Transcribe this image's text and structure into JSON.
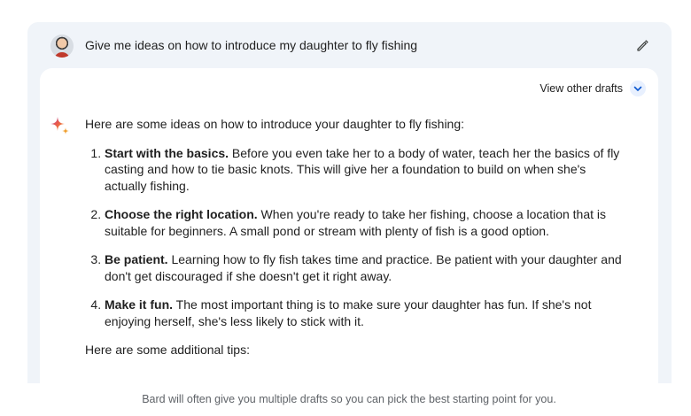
{
  "prompt": {
    "text": "Give me ideas on how to introduce my daughter to fly fishing",
    "avatar_icon": "user-avatar",
    "edit_icon": "pencil-icon"
  },
  "response": {
    "drafts_label": "View other drafts",
    "drafts_icon": "chevron-down-icon",
    "assistant_icon": "sparkle-icon",
    "intro": "Here are some ideas on how to introduce your daughter to fly fishing:",
    "items": [
      {
        "title": "Start with the basics.",
        "text": " Before you even take her to a body of water, teach her the basics of fly casting and how to tie basic knots. This will give her a foundation to build on when she's actually fishing."
      },
      {
        "title": "Choose the right location.",
        "text": " When you're ready to take her fishing, choose a location that is suitable for beginners. A small pond or stream with plenty of fish is a good option."
      },
      {
        "title": "Be patient.",
        "text": " Learning how to fly fish takes time and practice. Be patient with your daughter and don't get discouraged if she doesn't get it right away."
      },
      {
        "title": "Make it fun.",
        "text": " The most important thing is to make sure your daughter has fun. If she's not enjoying herself, she's less likely to stick with it."
      }
    ],
    "outro": "Here are some additional tips:"
  },
  "caption": "Bard will often give you multiple drafts so you can pick the best starting point for you.",
  "colors": {
    "frame_bg": "#f0f4f9",
    "card_bg": "#ffffff",
    "accent_blue": "#0b57d0",
    "caption_gray": "#5f6368"
  }
}
